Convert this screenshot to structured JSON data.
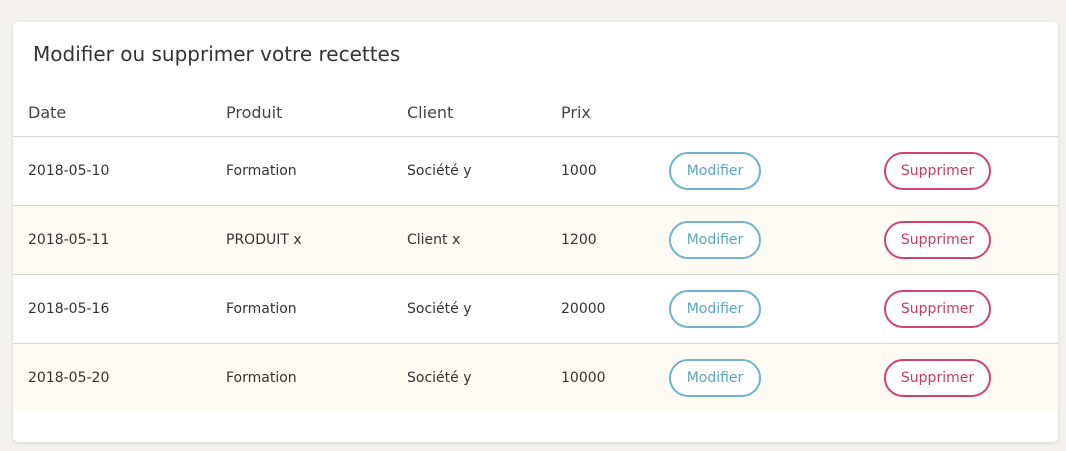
{
  "card": {
    "title": "Modifier ou supprimer votre recettes"
  },
  "table": {
    "headers": [
      "Date",
      "Produit",
      "Client",
      "Prix"
    ],
    "rows": [
      {
        "date": "2018-05-10",
        "produit": "Formation",
        "client": "Société y",
        "prix": "1000",
        "modifier": "Modifier",
        "supprimer": "Supprimer"
      },
      {
        "date": "2018-05-11",
        "produit": "PRODUIT x",
        "client": "Client x",
        "prix": "1200",
        "modifier": "Modifier",
        "supprimer": "Supprimer"
      },
      {
        "date": "2018-05-16",
        "produit": "Formation",
        "client": "Société y",
        "prix": "20000",
        "modifier": "Modifier",
        "supprimer": "Supprimer"
      },
      {
        "date": "2018-05-20",
        "produit": "Formation",
        "client": "Société y",
        "prix": "10000",
        "modifier": "Modifier",
        "supprimer": "Supprimer"
      }
    ]
  },
  "colors": {
    "modifier_accent": "#6fb3cc",
    "supprimer_accent": "#d2426e",
    "alt_row_background": "#fdfbf3"
  }
}
